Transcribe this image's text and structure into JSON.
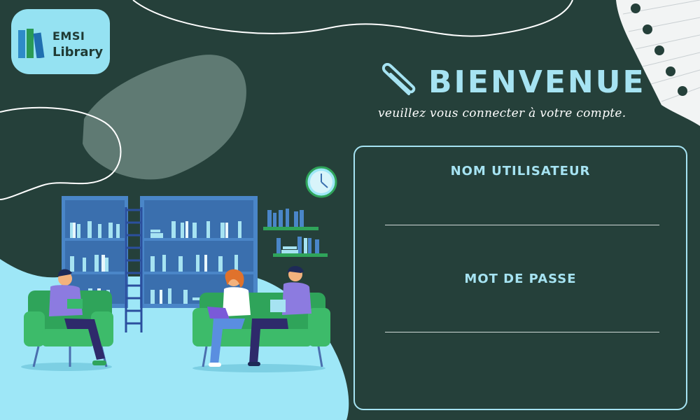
{
  "logo": {
    "line1": "EMSI",
    "line2": "Library"
  },
  "header": {
    "title": "BIENVENUE",
    "subtitle": "veuillez vous connecter à votre compte."
  },
  "login": {
    "username_label": "NOM UTILISATEUR",
    "username_value": "",
    "password_label": "MOT DE PASSE",
    "password_value": ""
  },
  "colors": {
    "background": "#25403a",
    "accent": "#a6e3f2",
    "light_blue": "#95e2f2",
    "shelf_blue": "#4a86c8",
    "chair_green": "#2fa45a"
  }
}
